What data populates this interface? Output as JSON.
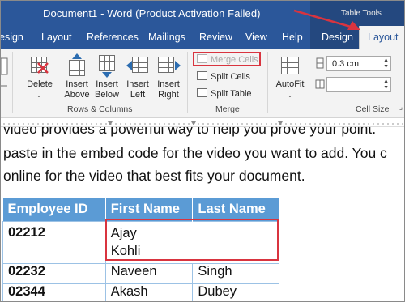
{
  "window": {
    "title": "Document1  -  Word (Product Activation Failed)",
    "contextual_group": "Table Tools"
  },
  "tabs": [
    {
      "label": "esign"
    },
    {
      "label": "Layout"
    },
    {
      "label": "References"
    },
    {
      "label": "Mailings"
    },
    {
      "label": "Review"
    },
    {
      "label": "View"
    },
    {
      "label": "Help"
    },
    {
      "label": "Design"
    },
    {
      "label": "Layout",
      "active": true
    }
  ],
  "ribbon": {
    "rows_columns": {
      "group_label": "Rows & Columns",
      "delete": "Delete",
      "insert_above": [
        "Insert",
        "Above"
      ],
      "insert_below": [
        "Insert",
        "Below"
      ],
      "insert_left": [
        "Insert",
        "Left"
      ],
      "insert_right": [
        "Insert",
        "Right"
      ]
    },
    "merge": {
      "group_label": "Merge",
      "merge_cells": "Merge Cells",
      "split_cells": "Split Cells",
      "split_table": "Split Table"
    },
    "autofit": "AutoFit",
    "cell_size": {
      "group_label": "Cell Size",
      "height_value": "0.3 cm",
      "width_value": ""
    }
  },
  "document": {
    "paragraph_lines": [
      "video provides a powerful way to help you prove your point.",
      "paste in the embed code for the video you want to add. You c",
      "online for the video that best fits your document."
    ],
    "table": {
      "headers": [
        "Employee ID",
        "First Name",
        "Last Name"
      ],
      "rows": [
        {
          "id": "02212",
          "merged_name_lines": [
            "Ajay",
            "Kohli"
          ]
        },
        {
          "id": "02232",
          "first": "Naveen",
          "last": "Singh"
        },
        {
          "id": "02344",
          "first": "Akash",
          "last": "Dubey"
        }
      ]
    }
  },
  "colors": {
    "word_blue": "#2b579a",
    "table_tools_blue": "#24487f",
    "table_header": "#5b9bd5",
    "annotation_red": "#d9343f"
  }
}
